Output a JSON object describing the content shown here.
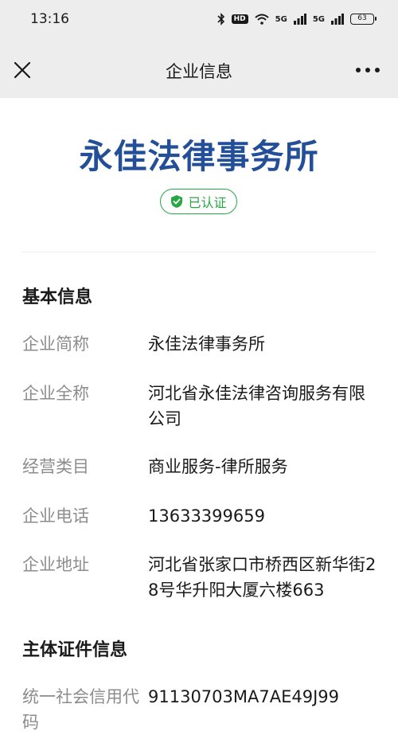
{
  "status_bar": {
    "time": "13:16",
    "network_1": "5G",
    "network_2": "5G",
    "battery": "63",
    "hd": "HD"
  },
  "nav": {
    "title": "企业信息",
    "close_icon": "close-icon",
    "more_icon": "more-icon"
  },
  "header": {
    "company_name": "永佳法律事务所",
    "verified_label": "已认证",
    "verified_color": "#28a745",
    "name_color": "#234f98"
  },
  "basic_info": {
    "title": "基本信息",
    "rows": [
      {
        "label": "企业简称",
        "value": "永佳法律事务所"
      },
      {
        "label": "企业全称",
        "value": "河北省永佳法律咨询服务有限公司"
      },
      {
        "label": "经营类目",
        "value": "商业服务-律所服务"
      },
      {
        "label": "企业电话",
        "value": "13633399659"
      },
      {
        "label": "企业地址",
        "value": "河北省张家口市桥西区新华街28号华升阳大厦六楼663"
      }
    ]
  },
  "certificate_info": {
    "title": "主体证件信息",
    "rows": [
      {
        "label": "统一社会信用代码",
        "value": "91130703MA7AE49J99"
      }
    ]
  }
}
